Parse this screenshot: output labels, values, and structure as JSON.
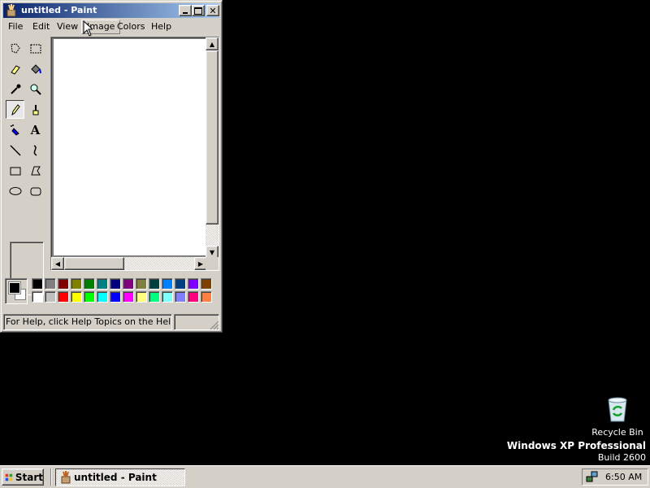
{
  "window": {
    "title": "untitled - Paint",
    "menu": [
      "File",
      "Edit",
      "View",
      "Image",
      "Colors",
      "Help"
    ],
    "status_text": "For Help, click Help Topics on the Help Menu"
  },
  "tools": [
    "free-form-select",
    "select",
    "eraser",
    "fill-with-color",
    "pick-color",
    "magnifier",
    "pencil",
    "brush",
    "airbrush",
    "text",
    "line",
    "curve",
    "rectangle",
    "polygon",
    "ellipse",
    "rounded-rectangle"
  ],
  "selected_tool": "pencil",
  "palette": {
    "foreground": "#000000",
    "background": "#ffffff",
    "row1": [
      "#000000",
      "#808080",
      "#800000",
      "#808000",
      "#008000",
      "#008080",
      "#000080",
      "#800080",
      "#808040",
      "#004040",
      "#0080ff",
      "#004080",
      "#8000ff",
      "#804000"
    ],
    "row2": [
      "#ffffff",
      "#c0c0c0",
      "#ff0000",
      "#ffff00",
      "#00ff00",
      "#00ffff",
      "#0000ff",
      "#ff00ff",
      "#ffff80",
      "#00ff80",
      "#80ffff",
      "#8080ff",
      "#ff0080",
      "#ff8040"
    ]
  },
  "desktop": {
    "recycle_bin_label": "Recycle Bin",
    "os_name": "Windows XP Professional",
    "os_build": "Build 2600"
  },
  "taskbar": {
    "start_label": "Start",
    "task_label": "untitled - Paint",
    "clock": "6:50 AM"
  },
  "colors": {
    "title_gradient_start": "#0a246a",
    "title_gradient_end": "#a6caf0",
    "face": "#d4d0c8",
    "desktop": "#000000"
  }
}
